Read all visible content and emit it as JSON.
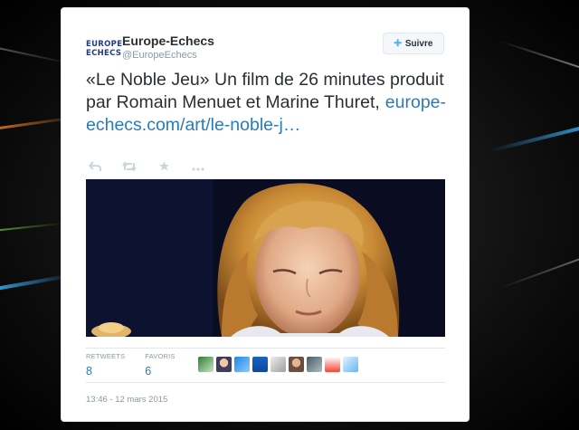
{
  "tweet": {
    "avatar_line1": "EUROPE",
    "avatar_line2": "ECHECS",
    "display_name": "Europe-Echecs",
    "handle": "@EuropeEchecs",
    "follow_label": "Suivre",
    "text": "«Le Noble Jeu» Un film de 26 minutes produit par Romain Menuet et Marine Thuret,",
    "link": "europe-echecs.com/art/le-noble-j…",
    "actions": [
      "reply-icon",
      "retweet-icon",
      "favorite-icon",
      "more-icon"
    ],
    "stats": [
      {
        "label": "RETWEETS",
        "value": "8"
      },
      {
        "label": "FAVORIS",
        "value": "6"
      }
    ],
    "favoriting_users_count": 9,
    "timestamp": "13:46 - 12 mars 2015"
  },
  "colors": {
    "link": "#2b7bb9",
    "brand": "#1f3c88",
    "follow_icon": "#55acee"
  }
}
